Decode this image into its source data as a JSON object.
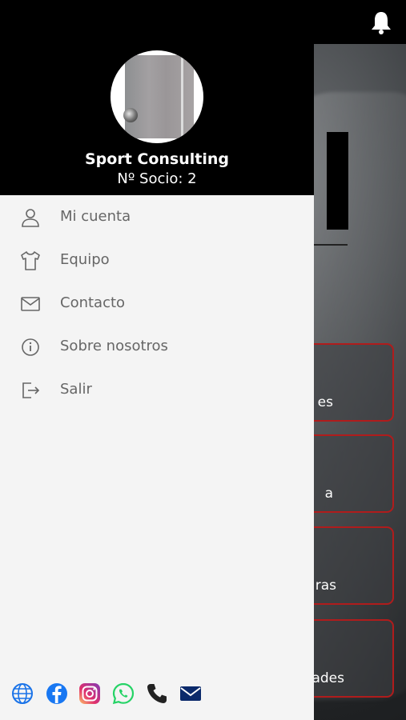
{
  "profile": {
    "name": "Sport Consulting",
    "member_line": "Nº Socio: 2"
  },
  "menu": {
    "items": [
      {
        "label": "Mi cuenta",
        "icon": "user-icon"
      },
      {
        "label": "Equipo",
        "icon": "shirt-icon"
      },
      {
        "label": "Contacto",
        "icon": "mail-icon"
      },
      {
        "label": "Sobre nosotros",
        "icon": "info-icon"
      },
      {
        "label": "Salir",
        "icon": "logout-icon"
      }
    ]
  },
  "background": {
    "tiles": [
      "es",
      "a",
      "ras",
      "ades"
    ]
  },
  "social": [
    "globe-icon",
    "facebook-icon",
    "instagram-icon",
    "whatsapp-icon",
    "phone-icon",
    "email-icon"
  ],
  "colors": {
    "drawer_bg": "#f4f4f4",
    "header_bg": "#000000",
    "tile_border": "#b01c1c",
    "facebook": "#1877f2",
    "whatsapp": "#25d366"
  }
}
